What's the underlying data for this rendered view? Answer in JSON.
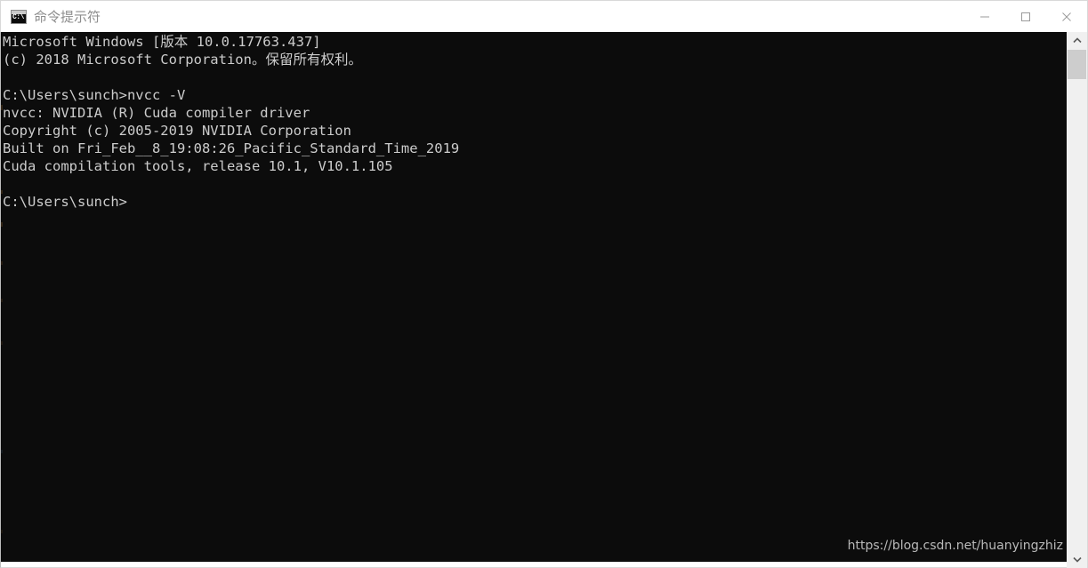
{
  "window": {
    "title": "命令提示符",
    "icon_name": "cmd-console-icon",
    "icon_text": "C:\\",
    "controls": {
      "minimize": "—",
      "maximize": "□",
      "close": "✕"
    },
    "colors": {
      "titlebar_bg": "#ffffff",
      "title_text": "#8d8d8d",
      "console_bg": "#0c0c0c",
      "console_text": "#cccccc",
      "scrollbar_track": "#f0f0f0",
      "scrollbar_thumb": "#cdcdcd",
      "watermark_text": "#b9b9b9"
    }
  },
  "console": {
    "lines": [
      "Microsoft Windows [版本 10.0.17763.437]",
      "(c) 2018 Microsoft Corporation。保留所有权利。",
      "",
      "C:\\Users\\sunch>nvcc -V",
      "nvcc: NVIDIA (R) Cuda compiler driver",
      "Copyright (c) 2005-2019 NVIDIA Corporation",
      "Built on Fri_Feb__8_19:08:26_Pacific_Standard_Time_2019",
      "Cuda compilation tools, release 10.1, V10.1.105",
      "",
      "C:\\Users\\sunch>"
    ],
    "text": "Microsoft Windows [版本 10.0.17763.437]\n(c) 2018 Microsoft Corporation。保留所有权利。\n\nC:\\Users\\sunch>nvcc -V\nnvcc: NVIDIA (R) Cuda compiler driver\nCopyright (c) 2005-2019 NVIDIA Corporation\nBuilt on Fri_Feb__8_19:08:26_Pacific_Standard_Time_2019\nCuda compilation tools, release 10.1, V10.1.105\n\nC:\\Users\\sunch>"
  },
  "watermark": {
    "text": "https://blog.csdn.net/huanyingzhiz"
  },
  "scrollbar": {
    "up_arrow": "⌃",
    "down_arrow": "⌄"
  }
}
